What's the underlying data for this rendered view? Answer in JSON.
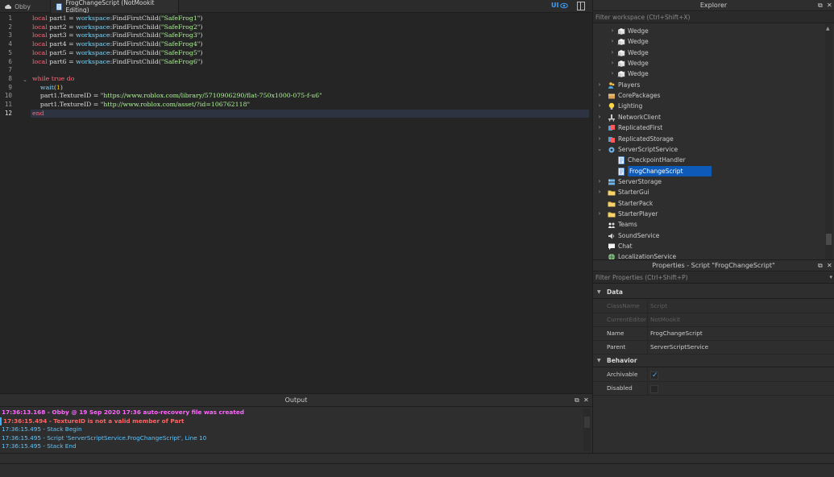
{
  "tabs": [
    {
      "label": "Obby",
      "active": false,
      "icon": "cloud-icon"
    },
    {
      "label": "FrogChangeScript (NotMookit Editing)",
      "active": true,
      "icon": "script-icon"
    }
  ],
  "ui_toggle": {
    "label": "UI",
    "icon": "eye-icon"
  },
  "editor": {
    "line_numbers": [
      "1",
      "2",
      "3",
      "4",
      "5",
      "6",
      "7",
      "8",
      "9",
      "10",
      "11",
      "12"
    ],
    "current_line": 12,
    "lines": [
      [
        {
          "t": "local",
          "c": "kw"
        },
        {
          "t": " part1 = ",
          "c": ""
        },
        {
          "t": "workspace",
          "c": "gl"
        },
        {
          "t": ":FindFirstChild(",
          "c": ""
        },
        {
          "t": "\"SafeFrog1\"",
          "c": "str"
        },
        {
          "t": ")",
          "c": ""
        }
      ],
      [
        {
          "t": "local",
          "c": "kw"
        },
        {
          "t": " part2 = ",
          "c": ""
        },
        {
          "t": "workspace",
          "c": "gl"
        },
        {
          "t": ":FindFirstChild(",
          "c": ""
        },
        {
          "t": "\"SafeFrog2\"",
          "c": "str"
        },
        {
          "t": ")",
          "c": ""
        }
      ],
      [
        {
          "t": "local",
          "c": "kw"
        },
        {
          "t": " part3 = ",
          "c": ""
        },
        {
          "t": "workspace",
          "c": "gl"
        },
        {
          "t": ":FindFirstChild(",
          "c": ""
        },
        {
          "t": "\"SafeFrog3\"",
          "c": "str"
        },
        {
          "t": ")",
          "c": ""
        }
      ],
      [
        {
          "t": "local",
          "c": "kw"
        },
        {
          "t": " part4 = ",
          "c": ""
        },
        {
          "t": "workspace",
          "c": "gl"
        },
        {
          "t": ":FindFirstChild(",
          "c": ""
        },
        {
          "t": "\"SafeFrog4\"",
          "c": "str"
        },
        {
          "t": ")",
          "c": ""
        }
      ],
      [
        {
          "t": "local",
          "c": "kw"
        },
        {
          "t": " part5 = ",
          "c": ""
        },
        {
          "t": "workspace",
          "c": "gl"
        },
        {
          "t": ":FindFirstChild(",
          "c": ""
        },
        {
          "t": "\"SafeFrog5\"",
          "c": "str"
        },
        {
          "t": ")",
          "c": ""
        }
      ],
      [
        {
          "t": "local",
          "c": "kw"
        },
        {
          "t": " part6 = ",
          "c": ""
        },
        {
          "t": "workspace",
          "c": "gl"
        },
        {
          "t": ":FindFirstChild(",
          "c": ""
        },
        {
          "t": "\"SafeFrog6\"",
          "c": "str"
        },
        {
          "t": ")",
          "c": ""
        }
      ],
      [],
      [
        {
          "t": "while",
          "c": "kw"
        },
        {
          "t": " ",
          "c": ""
        },
        {
          "t": "true",
          "c": "kw"
        },
        {
          "t": " ",
          "c": ""
        },
        {
          "t": "do",
          "c": "kw"
        }
      ],
      [
        {
          "t": "    ",
          "c": ""
        },
        {
          "t": "wait",
          "c": "gl"
        },
        {
          "t": "(",
          "c": ""
        },
        {
          "t": "1",
          "c": "num"
        },
        {
          "t": ")",
          "c": ""
        }
      ],
      [
        {
          "t": "    part1.TextureID = ",
          "c": ""
        },
        {
          "t": "\"https://www.roblox.com/library/5710906290/flat-750x1000-075-f-u6\"",
          "c": "str"
        }
      ],
      [
        {
          "t": "    part1.TextureID = ",
          "c": ""
        },
        {
          "t": "\"http://www.roblox.com/asset/?id=106762118\"",
          "c": "str"
        }
      ],
      [
        {
          "t": "end",
          "c": "kw"
        }
      ]
    ]
  },
  "output": {
    "title": "Output",
    "logs": [
      {
        "text": "17:36:13.168 - Obby @ 19 Sep 2020 17:36 auto-recovery file was created",
        "type": "warn"
      },
      {
        "time": "17:36:15.494",
        "msg": " - TextureID is not a valid member of Part",
        "type": "err"
      },
      {
        "text": "17:36:15.495 - Stack Begin",
        "type": "info"
      },
      {
        "text": "17:36:15.495 - Script 'ServerScriptService.FrogChangeScript', Line 10",
        "type": "info"
      },
      {
        "text": "17:36:15.495 - Stack End",
        "type": "info"
      }
    ]
  },
  "explorer": {
    "title": "Explorer",
    "filter_placeholder": "Filter workspace (Ctrl+Shift+X)",
    "items": [
      {
        "label": "Wedge",
        "depth": 1,
        "arrow": "right",
        "icon": "wedge-icon"
      },
      {
        "label": "Wedge",
        "depth": 1,
        "arrow": "right",
        "icon": "wedge-icon"
      },
      {
        "label": "Wedge",
        "depth": 1,
        "arrow": "right",
        "icon": "wedge-icon"
      },
      {
        "label": "Wedge",
        "depth": 1,
        "arrow": "right",
        "icon": "wedge-icon"
      },
      {
        "label": "Wedge",
        "depth": 1,
        "arrow": "right",
        "icon": "wedge-icon"
      },
      {
        "label": "Players",
        "depth": 0,
        "arrow": "right",
        "icon": "players-icon"
      },
      {
        "label": "CorePackages",
        "depth": 0,
        "arrow": "right",
        "icon": "package-icon"
      },
      {
        "label": "Lighting",
        "depth": 0,
        "arrow": "right",
        "icon": "lightbulb-icon"
      },
      {
        "label": "NetworkClient",
        "depth": 0,
        "arrow": "right",
        "icon": "network-icon"
      },
      {
        "label": "ReplicatedFirst",
        "depth": 0,
        "arrow": "right",
        "icon": "replicated-first-icon"
      },
      {
        "label": "ReplicatedStorage",
        "depth": 0,
        "arrow": "right",
        "icon": "replicated-storage-icon"
      },
      {
        "label": "ServerScriptService",
        "depth": 0,
        "arrow": "down",
        "icon": "server-script-service-icon"
      },
      {
        "label": "CheckpointHandler",
        "depth": 1,
        "arrow": "none",
        "icon": "script-icon"
      },
      {
        "label": "FrogChangeScript",
        "depth": 1,
        "arrow": "none",
        "icon": "script-icon",
        "selected": true
      },
      {
        "label": "ServerStorage",
        "depth": 0,
        "arrow": "right",
        "icon": "server-storage-icon"
      },
      {
        "label": "StarterGui",
        "depth": 0,
        "arrow": "right",
        "icon": "folder-icon"
      },
      {
        "label": "StarterPack",
        "depth": 0,
        "arrow": "none",
        "icon": "folder-icon"
      },
      {
        "label": "StarterPlayer",
        "depth": 0,
        "arrow": "right",
        "icon": "folder-icon"
      },
      {
        "label": "Teams",
        "depth": 0,
        "arrow": "none",
        "icon": "teams-icon"
      },
      {
        "label": "SoundService",
        "depth": 0,
        "arrow": "none",
        "icon": "sound-icon"
      },
      {
        "label": "Chat",
        "depth": 0,
        "arrow": "none",
        "icon": "chat-icon"
      },
      {
        "label": "LocalizationService",
        "depth": 0,
        "arrow": "none",
        "icon": "localization-icon"
      }
    ]
  },
  "properties": {
    "title": "Properties - Script \"FrogChangeScript\"",
    "filter_placeholder": "Filter Properties (Ctrl+Shift+P)",
    "sections": [
      {
        "label": "Data",
        "rows": [
          {
            "name": "ClassName",
            "value": "Script",
            "disabled": true
          },
          {
            "name": "CurrentEditor",
            "value": "NotMookit",
            "disabled": true
          },
          {
            "name": "Name",
            "value": "FrogChangeScript",
            "disabled": false
          },
          {
            "name": "Parent",
            "value": "ServerScriptService",
            "disabled": false
          }
        ]
      },
      {
        "label": "Behavior",
        "rows": [
          {
            "name": "Archivable",
            "checkbox": true,
            "checked": true
          },
          {
            "name": "Disabled",
            "checkbox": true,
            "checked": false
          }
        ]
      }
    ]
  },
  "panel_buttons": {
    "float": "⧉",
    "close": "✕"
  }
}
